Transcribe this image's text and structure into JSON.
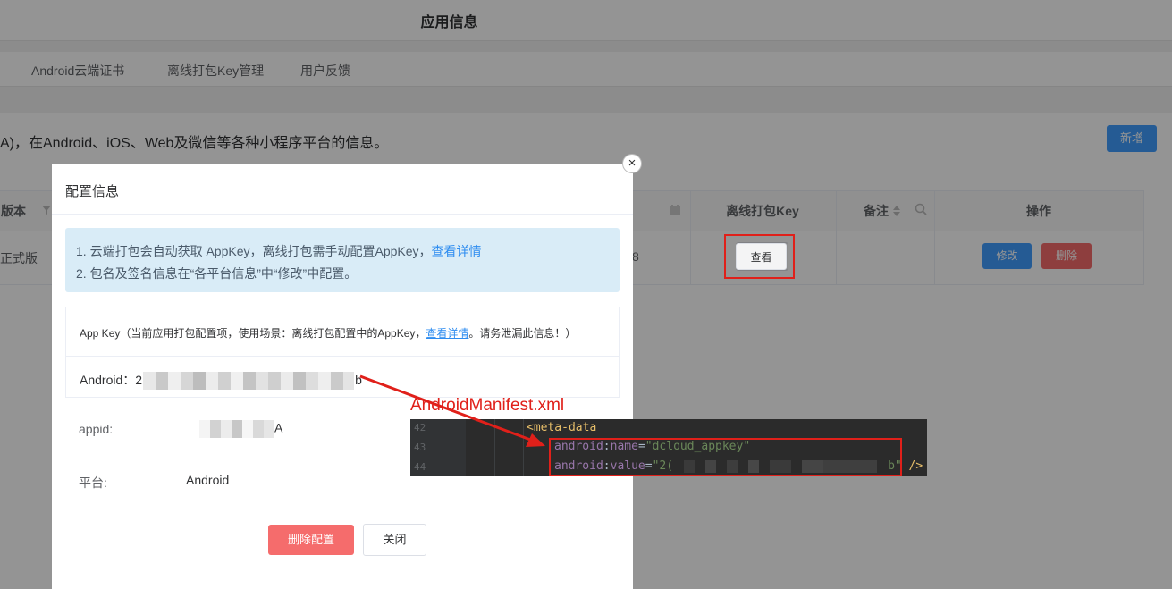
{
  "app": {
    "title": "应用信息"
  },
  "tabs": [
    {
      "label": "Android云端证书"
    },
    {
      "label": "离线打包Key管理"
    },
    {
      "label": "用户反馈"
    }
  ],
  "page": {
    "description": "A)，在Android、iOS、Web及微信等各种小程序平台的信息。",
    "new_button": "新增"
  },
  "table": {
    "headers": {
      "version": "版本",
      "offline_key": "离线打包Key",
      "remark": "备注",
      "actions": "操作"
    },
    "row": {
      "version": "正式版",
      "partial_value": "8",
      "view_button": "查看",
      "edit_button": "修改",
      "delete_button": "删除"
    }
  },
  "modal": {
    "title": "配置信息",
    "close_icon": "close-icon",
    "info": {
      "line1_text": "1. 云端打包会自动获取 AppKey，离线打包需手动配置AppKey，",
      "line1_link": "查看详情",
      "line2_text": "2. 包名及签名信息在“各平台信息”中“修改”中配置。"
    },
    "appkey": {
      "header_text": "App Key（当前应用打包配置项，使用场景：离线打包配置中的AppKey，",
      "header_link": "查看详情",
      "header_suffix": "。请务泄漏此信息！）",
      "android_label": "Android：",
      "value_prefix": "2",
      "value_suffix": "b"
    },
    "fields": {
      "appid_label": "appid:",
      "appid_suffix": "A",
      "platform_label": "平台:",
      "platform_value": "Android"
    },
    "delete_button": "删除配置",
    "close_button": "关闭"
  },
  "annotation": {
    "label": "AndroidManifest.xml",
    "code": {
      "line_numbers": [
        "42",
        "43",
        "44"
      ],
      "line1_tag": "<meta-data",
      "line2_attr": "android",
      "line2_colon": ":",
      "line2_name": "name",
      "line2_eq": "=",
      "line2_value": "\"dcloud_appkey\"",
      "line3_attr": "android",
      "line3_colon": ":",
      "line3_name": "value",
      "line3_eq": "=",
      "line3_value_prefix": "\"2(",
      "line3_value_suffix": "b\"",
      "line3_close": " />"
    },
    "highlight_color": "#e0201a"
  },
  "icons": [
    "filter-icon",
    "sort-icon",
    "search-icon",
    "calendar-icon",
    "close-icon"
  ]
}
